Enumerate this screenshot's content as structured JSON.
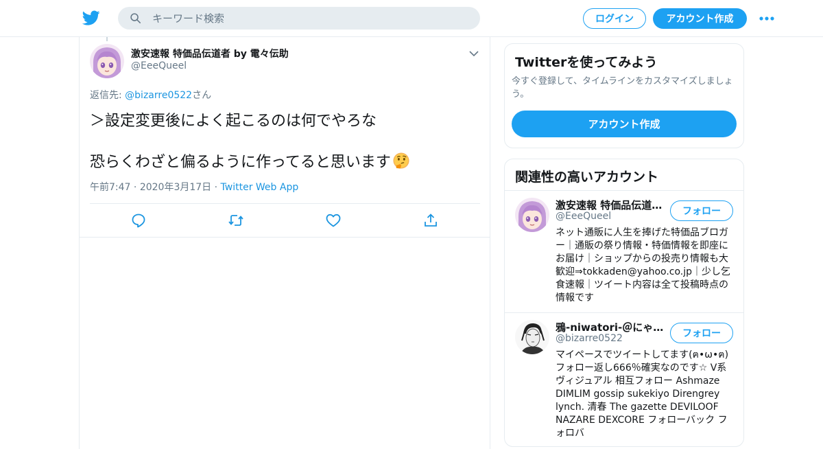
{
  "header": {
    "logo_icon": "twitter-bird-icon",
    "search_placeholder": "キーワード検索",
    "login_label": "ログイン",
    "signup_label": "アカウント作成",
    "more_icon": "more-dots-icon"
  },
  "tweet": {
    "display_name": "激安速報 特価品伝道者 by 電々伝助",
    "handle": "@EeeQueel",
    "reply_prefix": "返信先: ",
    "reply_to": "@bizarre0522",
    "reply_suffix": "さん",
    "text_line1": "＞設定変更後によく起こるのは何でやろな",
    "text_line2": "恐らくわざと偏るように作ってると思います",
    "emoji": "thinking-face-icon",
    "time": "午前7:47",
    "date": "2020年3月17日",
    "source": "Twitter Web App",
    "separator": " · "
  },
  "signup_card": {
    "title": "Twitterを使ってみよう",
    "description": "今すぐ登録して、タイムラインをカスタマイズしましょう。",
    "button_label": "アカウント作成"
  },
  "related": {
    "title": "関連性の高いアカウント",
    "accounts": [
      {
        "name": "激安速報 特価品伝道者 by 電々伝助",
        "handle": "@EeeQueel",
        "follow_label": "フォロー",
        "bio": "ネット通販に人生を捧げた特価品ブロガー｜通販の祭り情報・特価情報を即座にお届け｜ショップからの投売り情報も大歓迎⇒tokkaden@yahoo.co.jp｜少し乞食速報｜ツイート内容は全て投稿時点の情報です"
      },
      {
        "name": "鴉-niwatori-＠にゃーん",
        "handle": "@bizarre0522",
        "follow_label": "フォロー",
        "bio": "マイペースでツイートしてます(ฅ•ω•ฅ)フォロー返し666％確実なのです☆ V系 ヴィジュアル 相互フォロー Ashmaze DIMLIM gossip sukekiyo Direngrey lynch. 清春 The gazette DEVILOOF NAZARE DEXCORE フォローバック フォロバ"
      }
    ]
  },
  "colors": {
    "accent": "#1da1f2",
    "link": "#1b95e0",
    "muted": "#657786",
    "border": "#e6ecf0"
  }
}
